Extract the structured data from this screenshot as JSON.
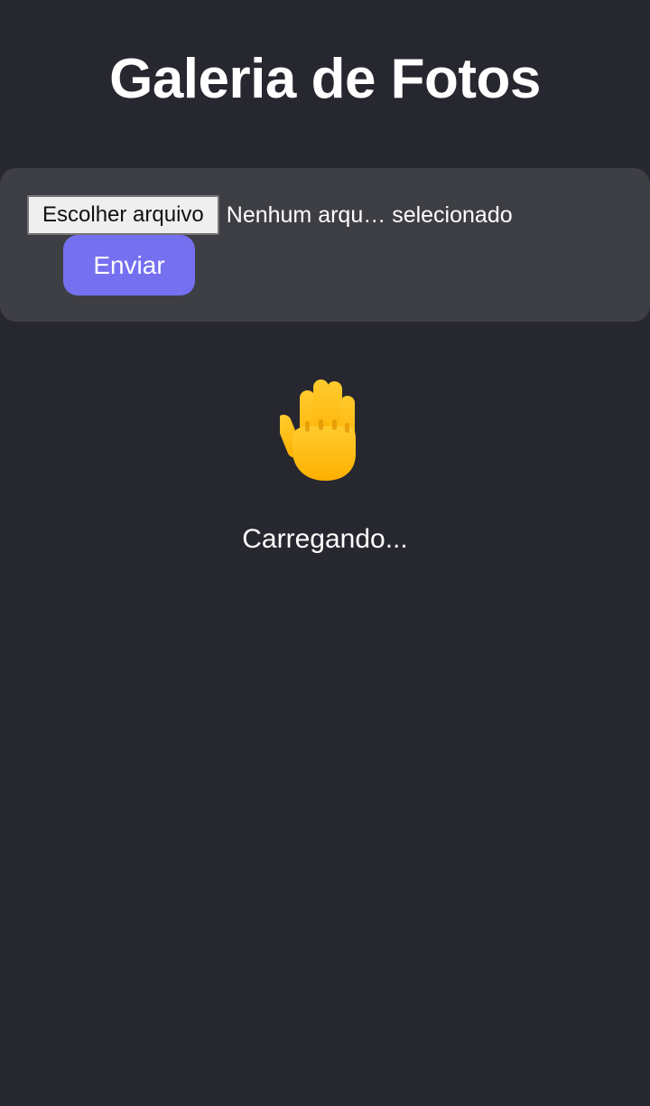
{
  "page": {
    "title": "Galeria de Fotos"
  },
  "upload": {
    "choose_file_label": "Escolher arquivo",
    "file_status": "Nenhum arqu… selecionado",
    "submit_label": "Enviar"
  },
  "loading": {
    "icon": "raised-hand-icon",
    "text": "Carregando..."
  },
  "colors": {
    "background": "#272730",
    "panel": "#3e3f44",
    "accent": "#7570f0",
    "text": "#ffffff"
  }
}
